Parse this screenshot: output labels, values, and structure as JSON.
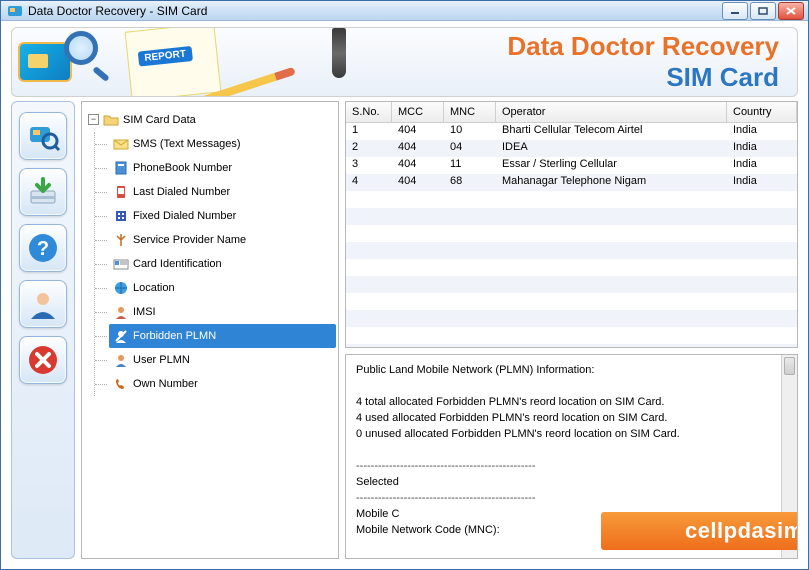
{
  "window": {
    "title": "Data Doctor Recovery - SIM Card"
  },
  "banner": {
    "title_line1": "Data Doctor Recovery",
    "title_line2": "SIM Card",
    "report_stamp": "REPORT"
  },
  "toolbar": {
    "scan_tip": "Scan SIM",
    "save_tip": "Save Recovered",
    "help_tip": "Help",
    "user_tip": "User",
    "close_tip": "Close"
  },
  "tree": {
    "root_label": "SIM Card Data",
    "items": [
      {
        "label": "SMS (Text Messages)",
        "icon": "envelope"
      },
      {
        "label": "PhoneBook Number",
        "icon": "phonebook"
      },
      {
        "label": "Last Dialed Number",
        "icon": "last-dialed"
      },
      {
        "label": "Fixed Dialed Number",
        "icon": "fixed-dialed"
      },
      {
        "label": "Service Provider Name",
        "icon": "antenna"
      },
      {
        "label": "Card Identification",
        "icon": "id-card"
      },
      {
        "label": "Location",
        "icon": "globe"
      },
      {
        "label": "IMSI",
        "icon": "imsi"
      },
      {
        "label": "Forbidden PLMN",
        "icon": "forbidden"
      },
      {
        "label": "User PLMN",
        "icon": "user-plmn"
      },
      {
        "label": "Own Number",
        "icon": "own-number"
      }
    ],
    "selected_index": 8
  },
  "grid": {
    "columns": [
      "S.No.",
      "MCC",
      "MNC",
      "Operator",
      "Country"
    ],
    "rows": [
      {
        "sno": "1",
        "mcc": "404",
        "mnc": "10",
        "operator": "Bharti Cellular Telecom Airtel",
        "country": "India"
      },
      {
        "sno": "2",
        "mcc": "404",
        "mnc": "04",
        "operator": "IDEA",
        "country": "India"
      },
      {
        "sno": "3",
        "mcc": "404",
        "mnc": "11",
        "operator": "Essar / Sterling Cellular",
        "country": "India"
      },
      {
        "sno": "4",
        "mcc": "404",
        "mnc": "68",
        "operator": "Mahanagar Telephone Nigam",
        "country": "India"
      }
    ]
  },
  "detail": {
    "heading": "Public Land Mobile Network (PLMN) Information:",
    "line_total": "4 total allocated Forbidden PLMN's reord location on SIM Card.",
    "line_used": "4 used allocated Forbidden PLMN's reord location on SIM Card.",
    "line_unused": "0 unused allocated Forbidden PLMN's reord location on SIM Card.",
    "sep1": "-------------------------------------------------",
    "selected_label": "Selected",
    "sep2": "-------------------------------------------------",
    "mobile_c_label": "Mobile C",
    "mobile_net_label": "Mobile Network Code (MNC):"
  },
  "watermark": "cellpdasim.com"
}
